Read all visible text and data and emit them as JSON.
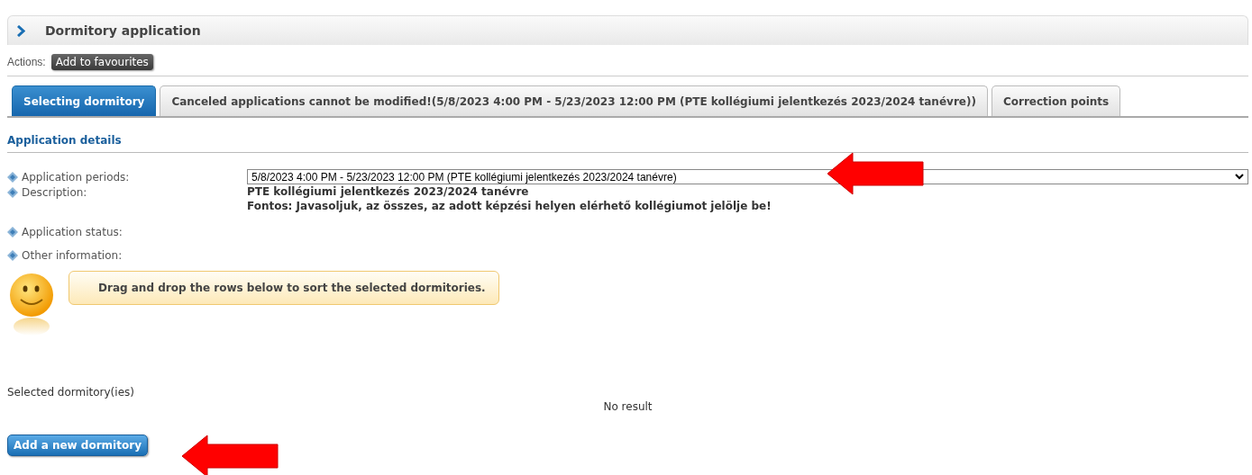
{
  "header": {
    "title": "Dormitory application"
  },
  "actions": {
    "label": "Actions:",
    "buttons": [
      "Add to favourites"
    ]
  },
  "tabs": [
    {
      "label": "Selecting dormitory",
      "selected": true
    },
    {
      "label": "Canceled applications cannot be modified!(5/8/2023 4:00 PM - 5/23/2023 12:00 PM (PTE kollégiumi jelentkezés 2023/2024 tanévre))",
      "selected": false
    },
    {
      "label": "Correction points",
      "selected": false
    }
  ],
  "section_title": "Application details",
  "fields": [
    {
      "kind": "select",
      "label": "Application periods:",
      "value": "5/8/2023 4:00 PM - 5/23/2023 12:00 PM (PTE kollégiumi jelentkezés 2023/2024 tanévre)"
    },
    {
      "kind": "text",
      "label": "Description:",
      "lines": [
        "PTE kollégiumi jelentkezés 2023/2024 tanévre",
        "Fontos: Javasoljuk, az összes, az adott képzési helyen elérhető kollégiumot jelölje be!"
      ]
    },
    {
      "kind": "empty",
      "label": "Application status:"
    },
    {
      "kind": "empty",
      "label": "Other information:"
    }
  ],
  "hint": "Drag and drop the rows below to sort the selected dormitories.",
  "selected_list": {
    "label": "Selected dormitory(ies)",
    "empty_text": "No result"
  },
  "add_button": "Add a new dormitory"
}
